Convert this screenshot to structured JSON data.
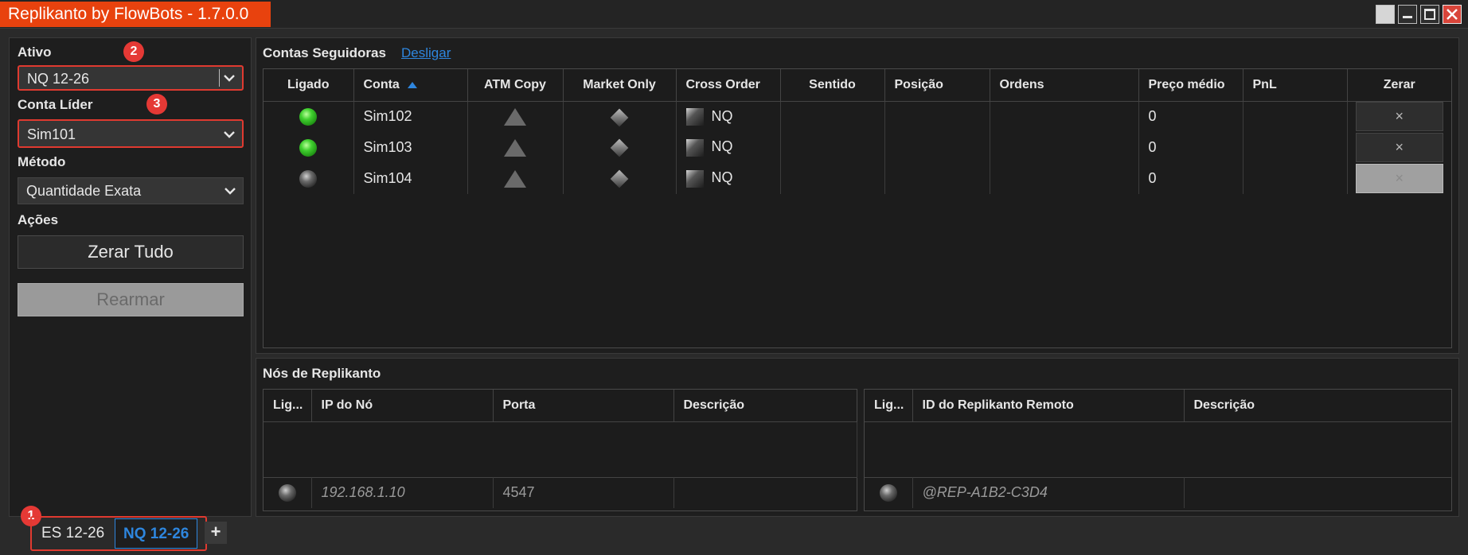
{
  "window": {
    "title": "Replikanto by FlowBots - 1.7.0.0"
  },
  "left_panel": {
    "asset_label": "Ativo",
    "asset_value": "NQ 12-26",
    "leader_label": "Conta Líder",
    "leader_value": "Sim101",
    "method_label": "Método",
    "method_value": "Quantidade Exata",
    "actions_label": "Ações",
    "reset_all_label": "Zerar Tudo",
    "rearm_label": "Rearmar"
  },
  "markers": [
    "1",
    "2",
    "3"
  ],
  "followers": {
    "title": "Contas Seguidoras",
    "disconnect_link": "Desligar",
    "columns": [
      "Ligado",
      "Conta",
      "ATM Copy",
      "Market Only",
      "Cross Order",
      "Sentido",
      "Posição",
      "Ordens",
      "Preço médio",
      "PnL",
      "Zerar"
    ],
    "rows": [
      {
        "status": "on",
        "account": "Sim102",
        "cross": "NQ",
        "sentido": "",
        "posicao": "",
        "ordens": "",
        "preco": "0",
        "pnl": "",
        "zerar": "×"
      },
      {
        "status": "on",
        "account": "Sim103",
        "cross": "NQ",
        "sentido": "",
        "posicao": "",
        "ordens": "",
        "preco": "0",
        "pnl": "",
        "zerar": "×"
      },
      {
        "status": "off",
        "account": "Sim104",
        "cross": "NQ",
        "sentido": "",
        "posicao": "",
        "ordens": "",
        "preco": "0",
        "pnl": "",
        "zerar": "×"
      }
    ]
  },
  "nodes": {
    "title": "Nós de Replikanto",
    "left_columns": [
      "Lig...",
      "IP do Nó",
      "Porta",
      "Descrição"
    ],
    "left_row": {
      "ip": "192.168.1.10",
      "port": "4547",
      "desc": ""
    },
    "right_columns": [
      "Lig...",
      "ID do Replikanto Remoto",
      "Descrição"
    ],
    "right_row": {
      "id": "@REP-A1B2-C3D4",
      "desc": ""
    }
  },
  "tabs": [
    "ES 12-26",
    "NQ 12-26"
  ],
  "add_tab_label": "+",
  "colors": {
    "accent": "#e8420e",
    "link": "#2e86de",
    "highlight": "#e03a30"
  }
}
